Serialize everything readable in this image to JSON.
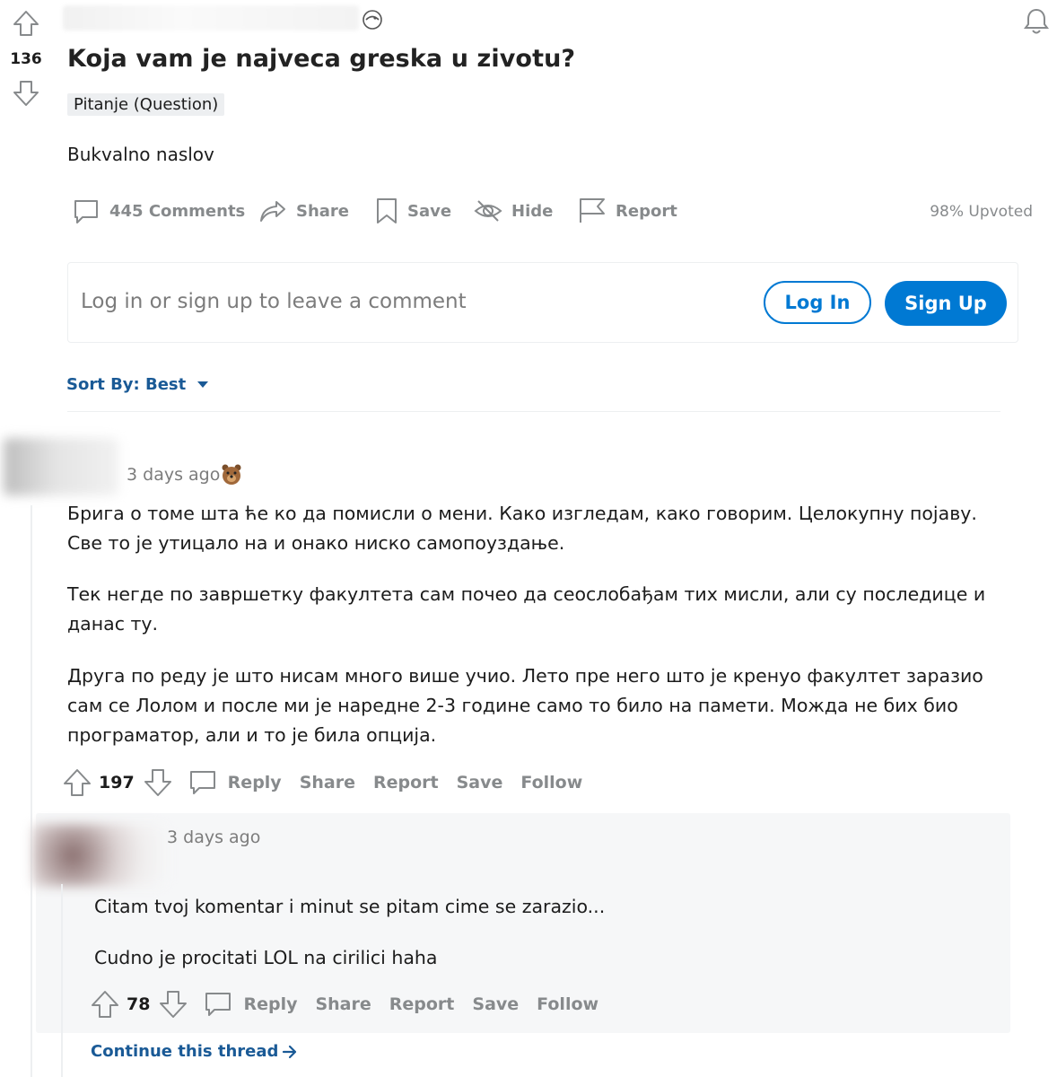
{
  "post": {
    "score": "136",
    "title": "Koja vam je najveca greska u zivotu?",
    "flair": "Pitanje (Question)",
    "body": "Bukvalno naslov",
    "actions": {
      "comments": "445 Comments",
      "share": "Share",
      "save": "Save",
      "hide": "Hide",
      "report": "Report"
    },
    "upvoted": "98% Upvoted"
  },
  "login_prompt": {
    "text": "Log in or sign up to leave a comment",
    "login_label": "Log In",
    "signup_label": "Sign Up"
  },
  "sort": {
    "label": "Sort By: Best"
  },
  "comments": [
    {
      "time": "3 days ago",
      "paragraphs": [
        "Брига о томе шта ће ко да помисли о мени. Како изгледам, како говорим. Целокупну појаву. Све то је утицало на и онако ниско самопоуздање.",
        "Тек негде по завршетку факултета сам почео да сеослобађам тих мисли, али су последице и данас ту.",
        "Друга по реду је што нисам много више учио. Лето пре него што је кренуо факултет заразио сам се Лолом и после ми је наредне 2-3 године само то било на памети. Можда не бих био програматор, али и то је била опција."
      ],
      "score": "197",
      "actions": [
        "Reply",
        "Share",
        "Report",
        "Save",
        "Follow"
      ]
    },
    {
      "time": "3 days ago",
      "paragraphs": [
        "Citam tvoj komentar i minut se pitam cime se zarazio...",
        "Cudno je procitati LOL na cirilici haha"
      ],
      "score": "78",
      "actions": [
        "Reply",
        "Share",
        "Report",
        "Save",
        "Follow"
      ]
    }
  ],
  "continue_thread": "Continue this thread",
  "colors": {
    "accent": "#0079d3",
    "muted": "#878a8c",
    "text": "#1c1c1c",
    "reply_bg": "#f6f7f8"
  },
  "icons": [
    "upvote-icon",
    "downvote-icon",
    "bell-icon",
    "comment-icon",
    "share-icon",
    "save-icon",
    "hide-icon",
    "report-icon",
    "caret-down-icon",
    "award-icon",
    "arrow-right-icon"
  ]
}
